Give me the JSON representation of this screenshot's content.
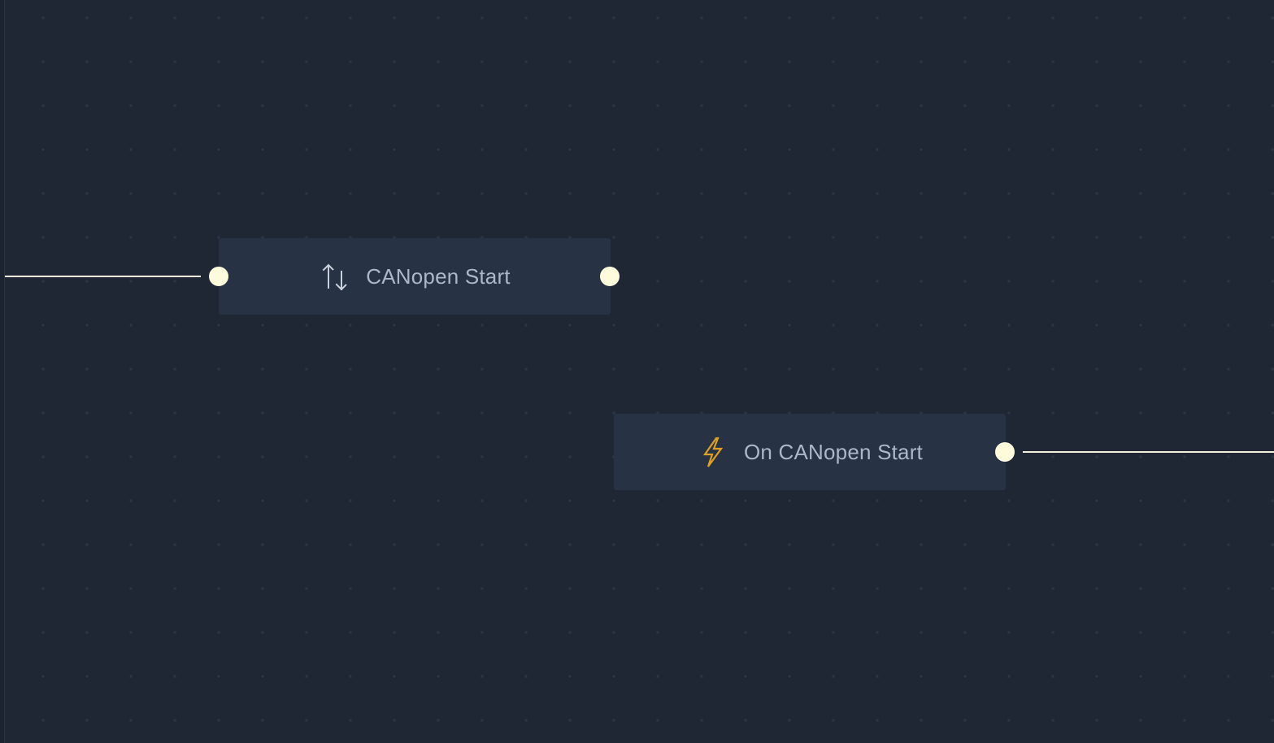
{
  "canvas": {
    "background_color": "#1f2735",
    "grid_dot_color": "#2b3546"
  },
  "nodes": [
    {
      "label": "CANopen Start",
      "icon": "swap-vertical-arrows-icon",
      "icon_color": "#c9d0dc"
    },
    {
      "label": "On CANopen Start",
      "icon": "lightning-bolt-icon",
      "icon_color": "#e0a020"
    }
  ],
  "colors": {
    "node_background": "#273244",
    "node_text": "#aeb7c7",
    "port": "#fdfbdc",
    "wire": "#f1efe0"
  }
}
